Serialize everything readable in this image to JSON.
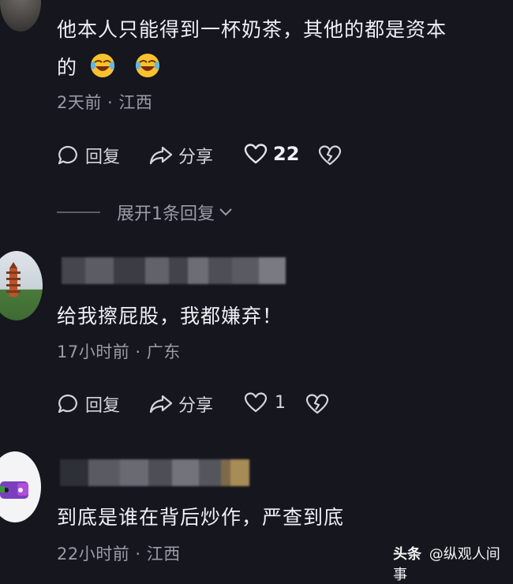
{
  "comments": [
    {
      "text_line1": "他本人只能得到一杯奶茶，其他的都是资本",
      "text_line2": "的",
      "emoji_icons": [
        "laughing-crying-emoji",
        "laughing-crying-emoji"
      ],
      "meta": "2天前 · 江西",
      "reply_label": "回复",
      "share_label": "分享",
      "like_count": "22",
      "expand_label": "展开1条回复"
    },
    {
      "text": "给我擦屁股，我都嫌弃！",
      "meta": "17小时前 · 广东",
      "reply_label": "回复",
      "share_label": "分享",
      "like_count": "1"
    },
    {
      "text": "到底是谁在背后炒作，严查到底",
      "meta": "22小时前 · 江西"
    }
  ],
  "watermark": {
    "brand": "头条",
    "handle": "@纵观人间事"
  },
  "icons": {
    "reply": "comment-bubble-icon",
    "share": "share-arrow-icon",
    "like": "heart-outline-icon",
    "dislike": "broken-heart-icon",
    "expand": "chevron-down-icon"
  },
  "colors": {
    "background": "#15161e",
    "text": "#eef0f4",
    "meta": "#9a9ca6"
  }
}
